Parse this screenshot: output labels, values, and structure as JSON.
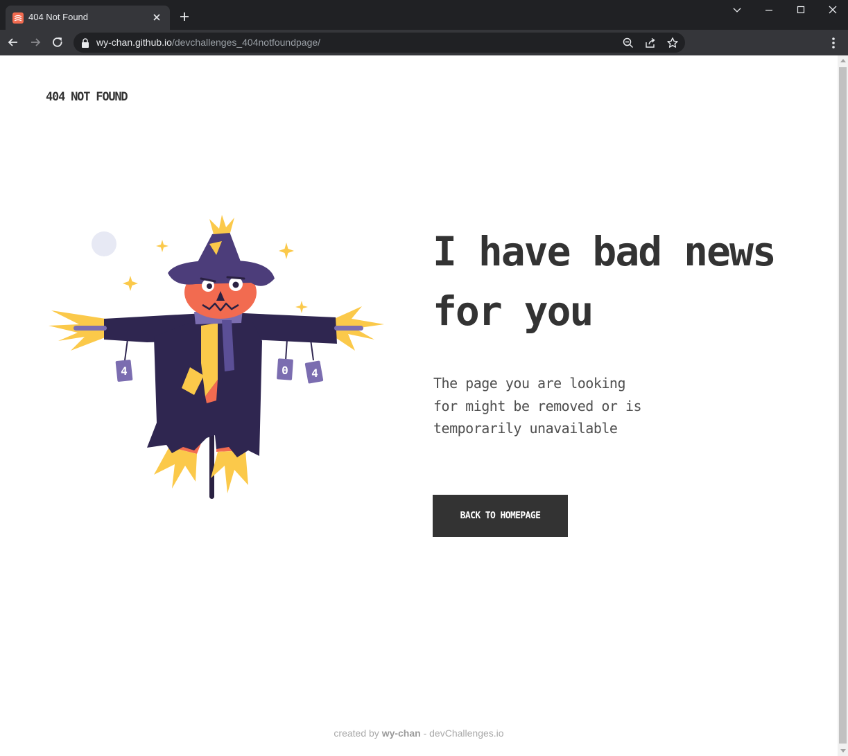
{
  "browser": {
    "tab_title": "404 Not Found",
    "url_host": "wy-chan.github.io",
    "url_path": "/devchallenges_404notfoundpage/"
  },
  "page": {
    "logo": "404 NOT FOUND",
    "headline_line1": "I have bad news",
    "headline_line2": "for you",
    "subtext_line1": "The page you are looking",
    "subtext_line2": "for might be removed or is",
    "subtext_line3": "temporarily unavailable",
    "cta_label": "BACK TO HOMEPAGE",
    "footer_prefix": "created by",
    "footer_author": "wy-chan",
    "footer_suffix": "- devChallenges.io",
    "tag_1": "4",
    "tag_2": "0",
    "tag_3": "4"
  },
  "colors": {
    "chrome_dark": "#202124",
    "chrome_tab": "#35363a",
    "text_dark": "#333333",
    "pumpkin": "#f26b50",
    "coat": "#2f2650",
    "hat": "#4c3d7a",
    "straw": "#fbc94a"
  }
}
